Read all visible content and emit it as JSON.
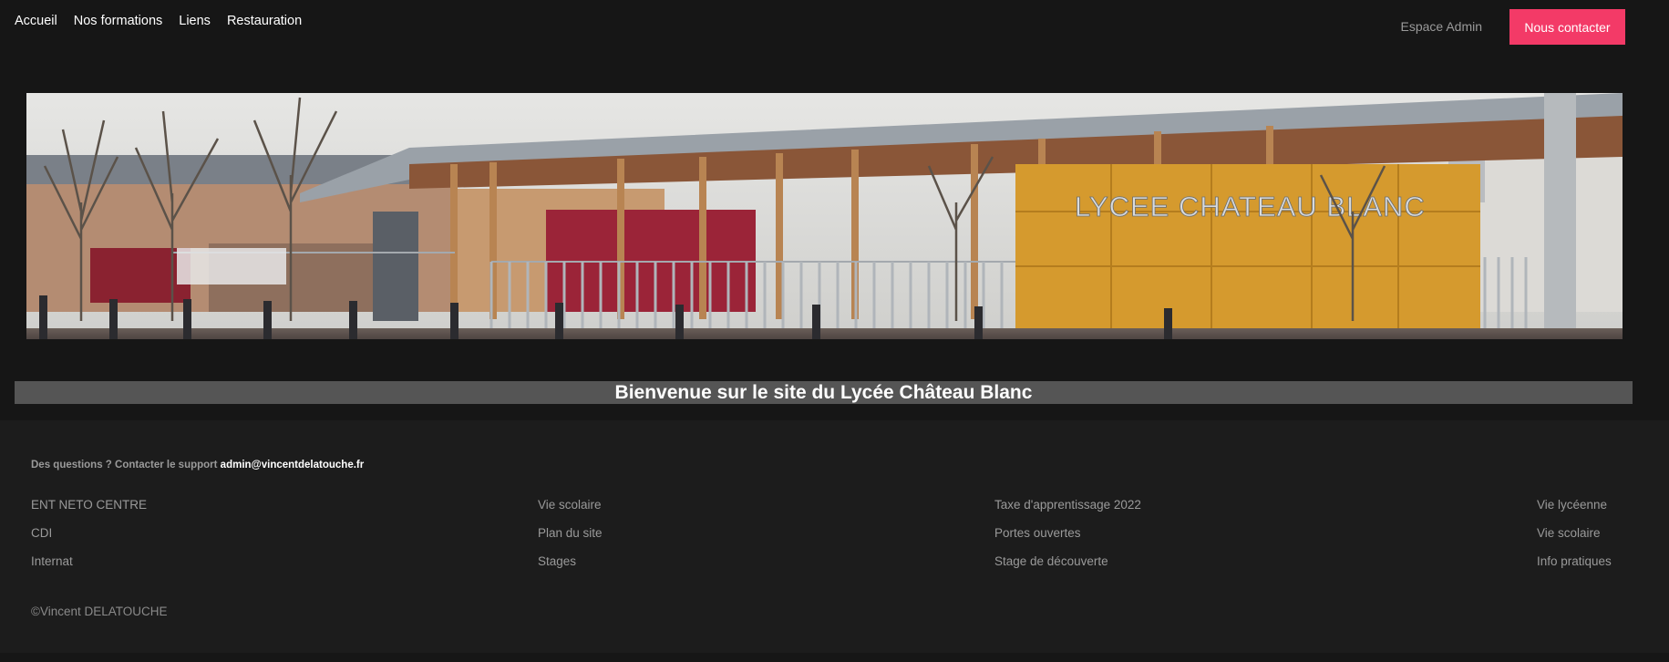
{
  "nav": {
    "items": [
      {
        "label": "Accueil"
      },
      {
        "label": "Nos formations"
      },
      {
        "label": "Liens"
      },
      {
        "label": "Restauration"
      }
    ],
    "admin_label": "Espace Admin",
    "contact_label": "Nous contacter"
  },
  "colors": {
    "accent": "#f33a67",
    "welcome_bg": "#555555",
    "background": "#161616"
  },
  "banner": {
    "sign_text": "LYCEE CHATEAU BLANC"
  },
  "welcome": {
    "title": "Bienvenue sur le site du Lycée Château Blanc"
  },
  "footer": {
    "support_text": "Des questions ? Contacter le support ",
    "support_email": "admin@vincentdelatouche.fr",
    "columns": [
      [
        "ENT NETO CENTRE",
        "CDI",
        "Internat"
      ],
      [
        "Vie scolaire",
        "Plan du site",
        "Stages"
      ],
      [
        "Taxe d'apprentissage 2022",
        "Portes ouvertes",
        "Stage de découverte"
      ],
      [
        "Vie lycéenne",
        "Vie scolaire",
        "Info pratiques"
      ]
    ],
    "copyright": "©Vincent DELATOUCHE"
  }
}
